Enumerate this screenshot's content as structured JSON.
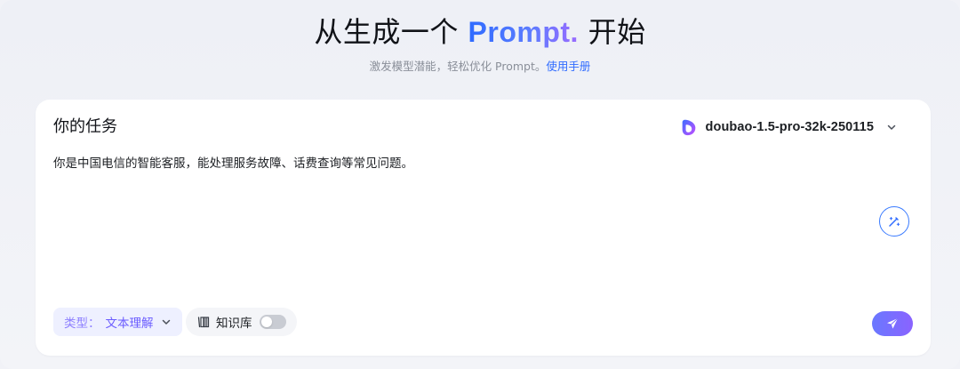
{
  "hero": {
    "title_prefix": "从生成一个",
    "title_brand": "Prompt.",
    "title_suffix": "开始",
    "subtitle": "激发模型潜能，轻松优化 Prompt。",
    "manual_link": "使用手册"
  },
  "card": {
    "title": "你的任务",
    "task_text": "你是中国电信的智能客服，能处理服务故障、话费查询等常见问题。"
  },
  "model": {
    "name": "doubao-1.5-pro-32k-250115",
    "logo_icon": "doubao-logo-icon",
    "dropdown_icon": "chevron-down-icon"
  },
  "type_selector": {
    "label": "类型：",
    "value": "文本理解"
  },
  "knowledge_base": {
    "label": "知识库",
    "enabled": false
  },
  "colors": {
    "brand_blue": "#2f6bff",
    "accent_purple": "#7c6bff",
    "send_gradient_start": "#6a78ff",
    "send_gradient_end": "#8a63ff"
  }
}
